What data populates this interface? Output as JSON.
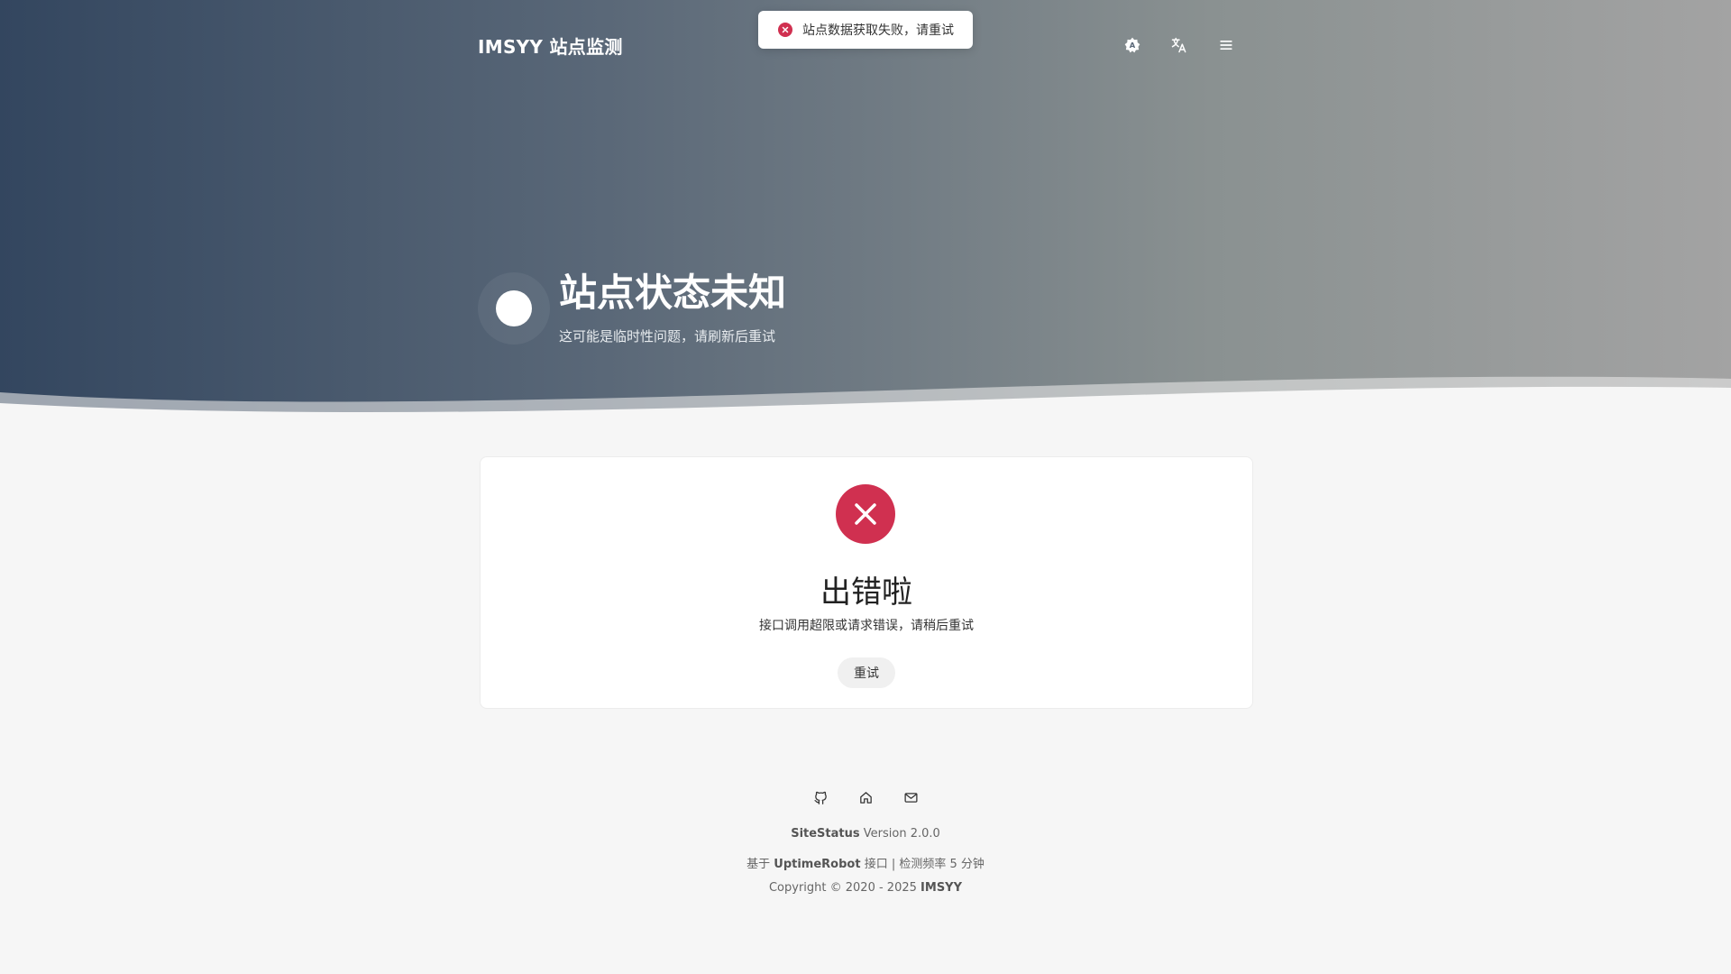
{
  "header": {
    "brand": "IMSYY 站点监测",
    "buttons": [
      {
        "icon": "theme-icon"
      },
      {
        "icon": "translate-icon"
      },
      {
        "icon": "menu-icon"
      }
    ]
  },
  "toast": {
    "message": "站点数据获取失败，请重试",
    "icon": "error-icon",
    "color": "#d03050"
  },
  "status": {
    "title": "站点状态未知",
    "subtitle": "这可能是临时性问题，请刷新后重试"
  },
  "error_card": {
    "title": "出错啦",
    "description": "接口调用超限或请求错误，请稍后重试",
    "retry_label": "重试",
    "icon": "close-icon"
  },
  "footer": {
    "links": [
      {
        "icon": "github-icon"
      },
      {
        "icon": "home-icon"
      },
      {
        "icon": "mail-icon"
      }
    ],
    "app_name": "SiteStatus",
    "version": "Version 2.0.0",
    "based_prefix": "基于",
    "based_name": "UptimeRobot",
    "based_suffix": "接口 | 检测频率 5 分钟",
    "copyright_prefix": "Copyright © 2020 - 2025",
    "copyright_owner": "IMSYY"
  },
  "colors": {
    "error": "#d03050",
    "background": "#f6f6f6"
  }
}
